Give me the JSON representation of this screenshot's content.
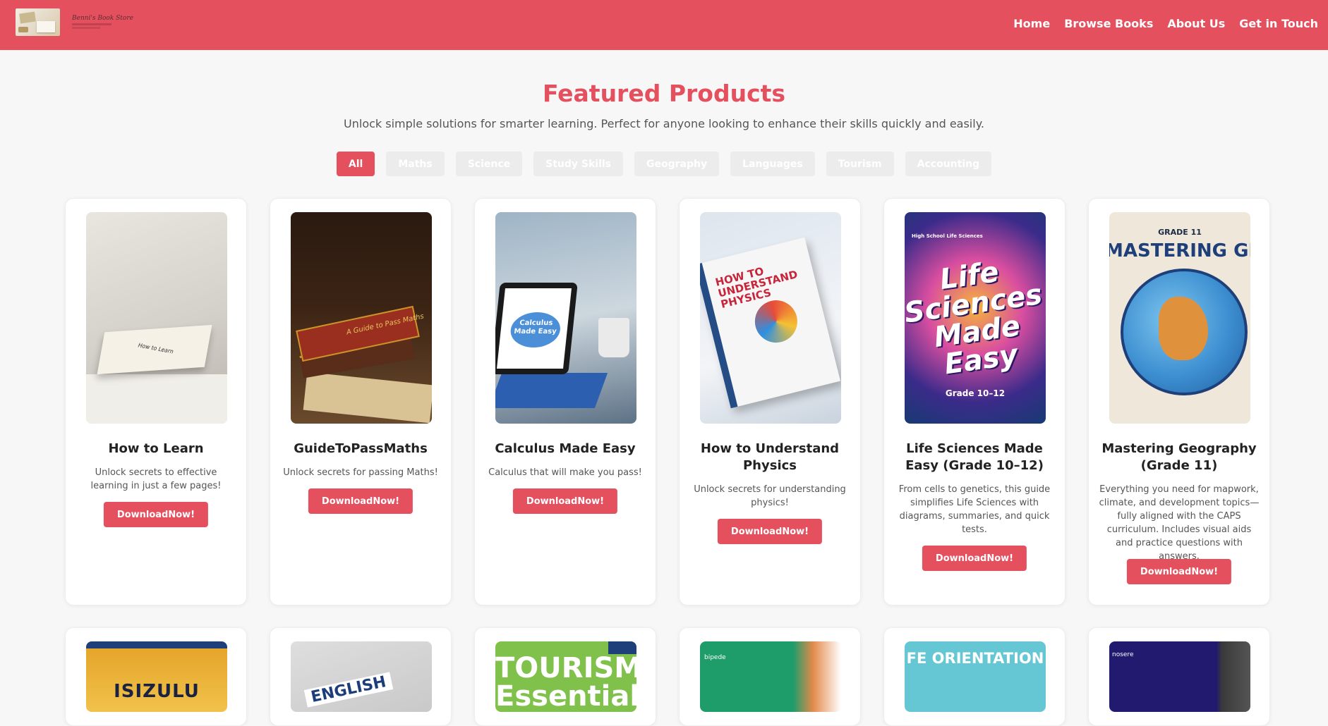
{
  "nav": {
    "logo_text": "Benni's Book Store",
    "links": [
      "Home",
      "Browse Books",
      "About Us",
      "Get in Touch"
    ]
  },
  "section": {
    "title": "Featured Products",
    "subtitle": "Unlock simple solutions for smarter learning. Perfect for anyone looking to enhance their skills quickly and easily."
  },
  "filters": [
    "All",
    "Maths",
    "Science",
    "Study Skills",
    "Geography",
    "Languages",
    "Tourism",
    "Accounting"
  ],
  "active_filter": "All",
  "colors": {
    "accent": "#e5505f",
    "background": "#f7f7f7"
  },
  "products": [
    {
      "title": "How to Learn",
      "description": "Unlock secrets to effective learning in just a few pages!",
      "button": "DownloadNow!",
      "cover_text": "How to Learn"
    },
    {
      "title": "GuideToPassMaths",
      "description": "Unlock secrets for passing Maths!",
      "button": "DownloadNow!",
      "cover_text": "A Guide to Pass Maths"
    },
    {
      "title": "Calculus Made Easy",
      "description": "Calculus that will make you pass!",
      "button": "DownloadNow!",
      "cover_text": "Calculus Made Easy"
    },
    {
      "title": "How to Understand Physics",
      "description": "Unlock secrets for understanding physics!",
      "button": "DownloadNow!",
      "cover_text": "HOW TO UNDERSTAND PHYSICS"
    },
    {
      "title": "Life Sciences Made Easy (Grade 10–12)",
      "description": "From cells to genetics, this guide simplifies Life Sciences with diagrams, summaries, and quick tests.",
      "button": "DownloadNow!",
      "cover_small": "High School Life Sciences",
      "cover_text": "Life Sciences Made Easy",
      "cover_grade": "Grade 10–12"
    },
    {
      "title": "Mastering Geography (Grade 11)",
      "description": "Everything you need for mapwork, climate, and development topics—fully aligned with the CAPS curriculum. Includes visual aids and practice questions with answers.",
      "button": "DownloadNow!",
      "cover_grade": "GRADE 11",
      "cover_text": "MASTERING GEOGRAPHY"
    }
  ],
  "products_row2": [
    {
      "cover_text": "ISIZULU"
    },
    {
      "cover_text": "ENGLISH"
    },
    {
      "cover_text": "TOURISM Essentials"
    },
    {
      "cover_text": "bipede"
    },
    {
      "cover_text": "FE ORIENTATION"
    },
    {
      "cover_text": "nosere"
    }
  ]
}
